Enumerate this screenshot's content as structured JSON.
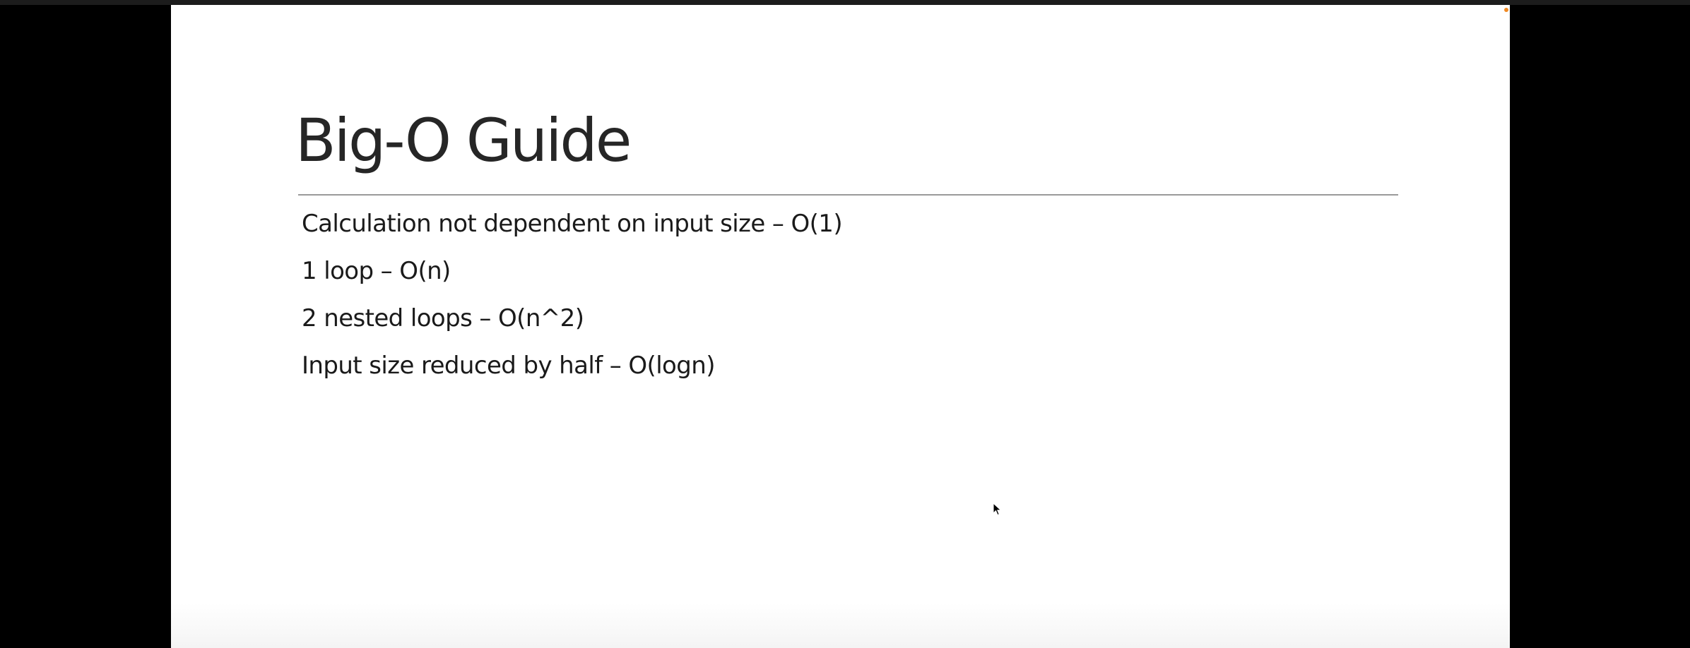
{
  "presentation": {
    "slide": {
      "title": "Big-O Guide",
      "bullets": [
        "Calculation not dependent on input size – O(1)",
        "1 loop – O(n)",
        "2 nested loops – O(n^2)",
        "Input size reduced by half – O(logn)"
      ]
    }
  },
  "icons": {
    "cursor": "mouse-pointer-icon",
    "recording": "recording-dot-icon"
  },
  "colors": {
    "background": "#000000",
    "slide": "#ffffff",
    "title": "#262626",
    "body_text": "#1a1a1a",
    "rule": "#9a9a9a",
    "recording_dot": "#f08a24"
  }
}
